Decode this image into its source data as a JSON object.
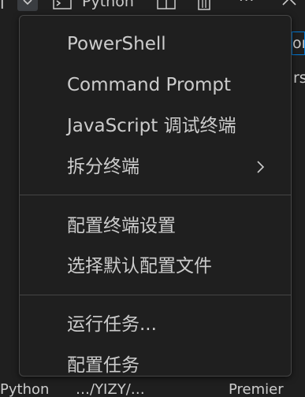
{
  "background": {
    "toolbar": {
      "edge_glyph": "ı",
      "python_label": "Python",
      "more_glyph": "···"
    },
    "right_tab_text": "on",
    "right_text": "rs",
    "bottom_row": {
      "left_text": "Python",
      "middle_text": "…/YIZY/…",
      "right_text": "Premier"
    }
  },
  "menu": {
    "items": [
      {
        "label": "PowerShell"
      },
      {
        "label": "Command Prompt"
      },
      {
        "label": "JavaScript 调试终端"
      },
      {
        "label": "拆分终端",
        "has_submenu": true
      },
      {
        "label": "配置终端设置"
      },
      {
        "label": "选择默认配置文件"
      },
      {
        "label": "运行任务..."
      },
      {
        "label": "配置任务"
      }
    ]
  },
  "colors": {
    "menu_bg": "#1f1f1f",
    "menu_border": "#454545",
    "text": "#cccccc",
    "focus_border": "#0078d4"
  }
}
